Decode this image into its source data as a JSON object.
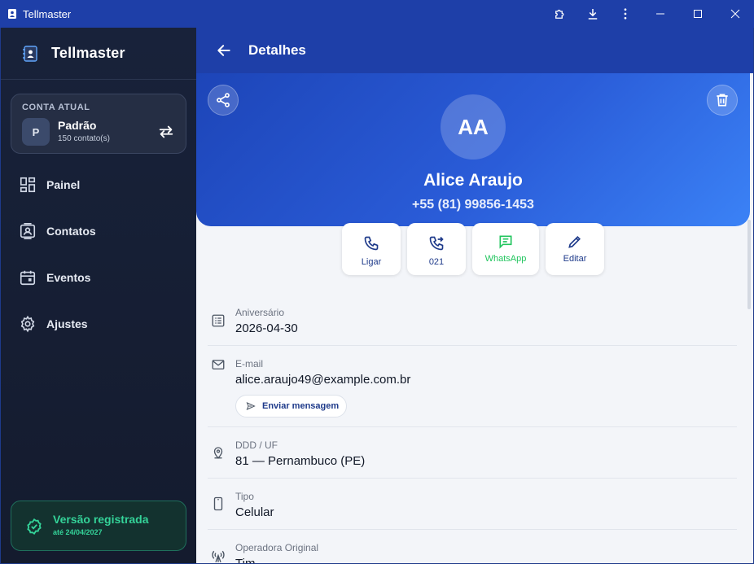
{
  "window": {
    "title": "Tellmaster"
  },
  "sidebar": {
    "brand": "Tellmaster",
    "account": {
      "label": "CONTA ATUAL",
      "initial": "P",
      "name": "Padrão",
      "count": "150 contato(s)"
    },
    "nav": [
      {
        "label": "Painel",
        "icon": "dashboard-icon"
      },
      {
        "label": "Contatos",
        "icon": "contacts-icon"
      },
      {
        "label": "Eventos",
        "icon": "calendar-icon"
      },
      {
        "label": "Ajustes",
        "icon": "gear-icon"
      }
    ],
    "version": {
      "title": "Versão registrada",
      "subtitle": "até 24/04/2027"
    }
  },
  "main": {
    "title": "Detalhes",
    "contact": {
      "initials": "AA",
      "name": "Alice Araujo",
      "phone": "+55 (81) 99856-1453"
    },
    "actions": [
      {
        "label": "Ligar",
        "icon": "phone-icon"
      },
      {
        "label": "021",
        "icon": "phone-forward-icon"
      },
      {
        "label": "WhatsApp",
        "icon": "message-icon"
      },
      {
        "label": "Editar",
        "icon": "pencil-icon"
      }
    ],
    "details": [
      {
        "label": "Aniversário",
        "value": "2026-04-30",
        "icon": "calendar-list-icon"
      },
      {
        "label": "E-mail",
        "value": "alice.araujo49@example.com.br",
        "icon": "mail-icon",
        "action": "Enviar mensagem"
      },
      {
        "label": "DDD / UF",
        "value": "81 — Pernambuco (PE)",
        "icon": "location-pin-icon"
      },
      {
        "label": "Tipo",
        "value": "Celular",
        "icon": "mobile-phone-icon"
      },
      {
        "label": "Operadora Original",
        "value": "Tim",
        "icon": "antenna-icon"
      }
    ]
  },
  "colors": {
    "primary": "#1e3fa8",
    "sidebar": "#18223a",
    "success": "#34d399",
    "whatsapp": "#22c55e"
  }
}
